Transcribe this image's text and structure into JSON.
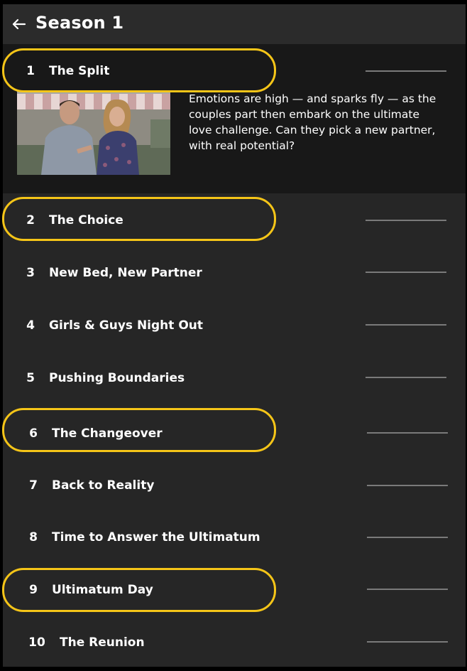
{
  "header": {
    "title": "Season 1",
    "back_icon": "arrow-left-icon"
  },
  "episodes": [
    {
      "number": "1",
      "title": "The Split",
      "progress": 0,
      "expanded": true,
      "description": "Emotions are high — and sparks fly — as the couples part then embark on the ultimate love challenge. Can they pick a new partner, with real potential?",
      "highlighted": true
    },
    {
      "number": "2",
      "title": "The Choice",
      "progress": 0,
      "highlighted": true
    },
    {
      "number": "3",
      "title": "New Bed, New Partner",
      "progress": 0,
      "highlighted": false
    },
    {
      "number": "4",
      "title": "Girls & Guys Night Out",
      "progress": 0,
      "highlighted": false
    },
    {
      "number": "5",
      "title": "Pushing Boundaries",
      "progress": 0,
      "highlighted": false
    },
    {
      "number": "6",
      "title": "The Changeover",
      "progress": 0,
      "highlighted": true
    },
    {
      "number": "7",
      "title": "Back to Reality",
      "progress": 0,
      "highlighted": false
    },
    {
      "number": "8",
      "title": "Time to Answer the Ultimatum",
      "progress": 0,
      "highlighted": false
    },
    {
      "number": "9",
      "title": "Ultimatum Day",
      "progress": 0,
      "highlighted": true
    },
    {
      "number": "10",
      "title": "The Reunion",
      "progress": 0,
      "highlighted": false
    }
  ],
  "colors": {
    "background": "#262626",
    "expanded_row": "#181818",
    "highlight_outline": "#f5c518",
    "progress_track": "#7a7a7a",
    "progress_fill": "#e50914"
  }
}
